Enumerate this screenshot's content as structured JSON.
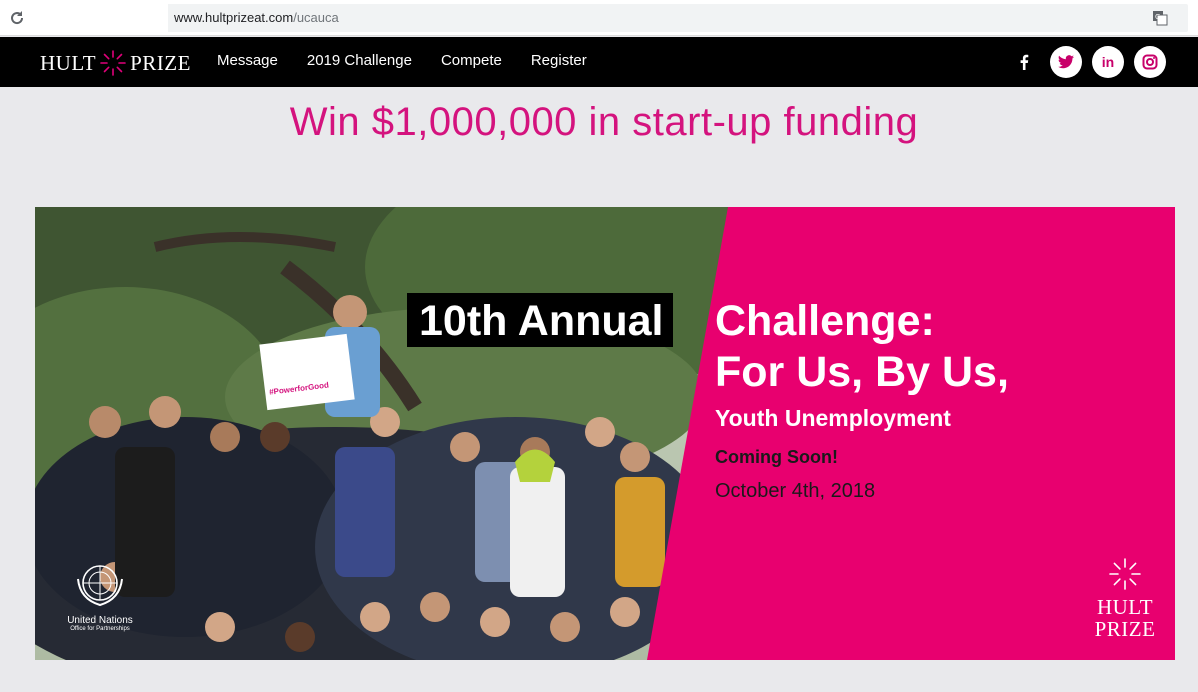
{
  "browser": {
    "url_domain": "www.hultprizeat.com",
    "url_path": "/ucauca"
  },
  "nav": {
    "logo_left": "HULT",
    "logo_right": "PRIZE",
    "items": [
      {
        "label": "Message"
      },
      {
        "label": "2019 Challenge"
      },
      {
        "label": "Compete"
      },
      {
        "label": "Register"
      }
    ],
    "social": [
      "facebook-icon",
      "twitter-icon",
      "linkedin-icon",
      "instagram-icon"
    ],
    "linkedin_label": "in"
  },
  "headline": "Win $1,000,000 in start-up funding",
  "hero": {
    "line1": "10th Annual",
    "line1b": "Challenge:",
    "line2": "For Us, By Us,",
    "subtitle": "Youth Unemployment",
    "coming": "Coming Soon!",
    "date": "October 4th, 2018",
    "sign_text": "#PowerforGood",
    "un_name": "United Nations",
    "un_sub": "Office for Partnerships",
    "hp_top": "HULT",
    "hp_bottom": "PRIZE"
  },
  "colors": {
    "brand_pink": "#e8006f",
    "headline_pink": "#d4137e",
    "nav_bg": "#000000",
    "page_bg": "#e9e9ec"
  }
}
